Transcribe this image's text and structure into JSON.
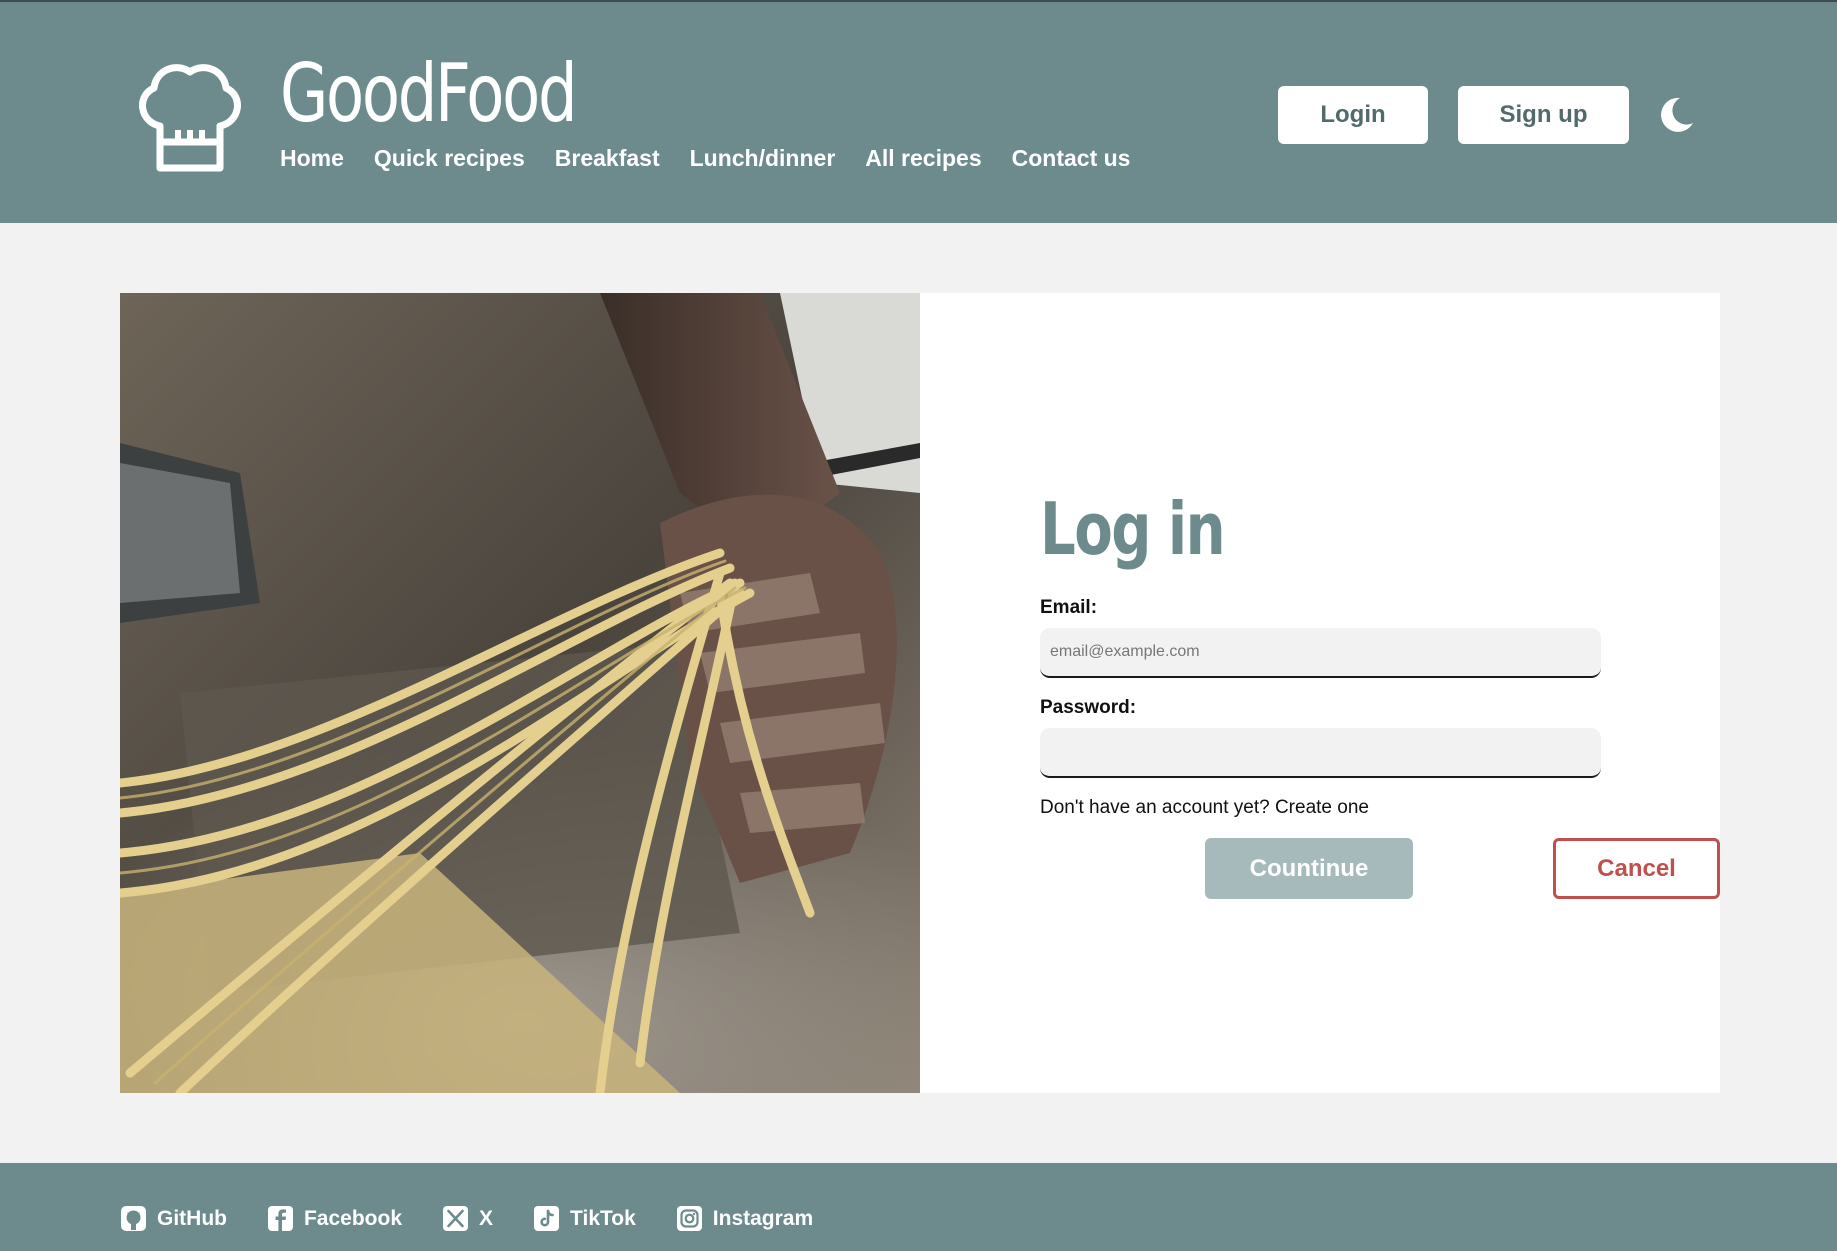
{
  "header": {
    "brand": "GoodFood",
    "nav": [
      "Home",
      "Quick recipes",
      "Breakfast",
      "Lunch/dinner",
      "All recipes",
      "Contact us"
    ],
    "login_label": "Login",
    "signup_label": "Sign up",
    "logo_icon": "chef-hat-icon",
    "theme_icon": "moon-icon"
  },
  "form": {
    "title": "Log in",
    "email_label": "Email:",
    "email_placeholder": "email@example.com",
    "email_value": "",
    "password_label": "Password:",
    "password_value": "",
    "signup_hint": "Don't have an account yet? Create one",
    "continue_label": "Countinue",
    "cancel_label": "Cancel"
  },
  "footer": {
    "social": [
      {
        "label": "GitHub",
        "icon": "github-icon"
      },
      {
        "label": "Facebook",
        "icon": "facebook-icon"
      },
      {
        "label": "X",
        "icon": "x-icon"
      },
      {
        "label": "TikTok",
        "icon": "tiktok-icon"
      },
      {
        "label": "Instagram",
        "icon": "instagram-icon"
      }
    ]
  },
  "colors": {
    "header_bg": "#6d8b8c",
    "accent": "#6d8b8c",
    "continue_bg": "#a6b9bb",
    "cancel": "#c0504d",
    "page_bg": "#f2f2f2"
  }
}
